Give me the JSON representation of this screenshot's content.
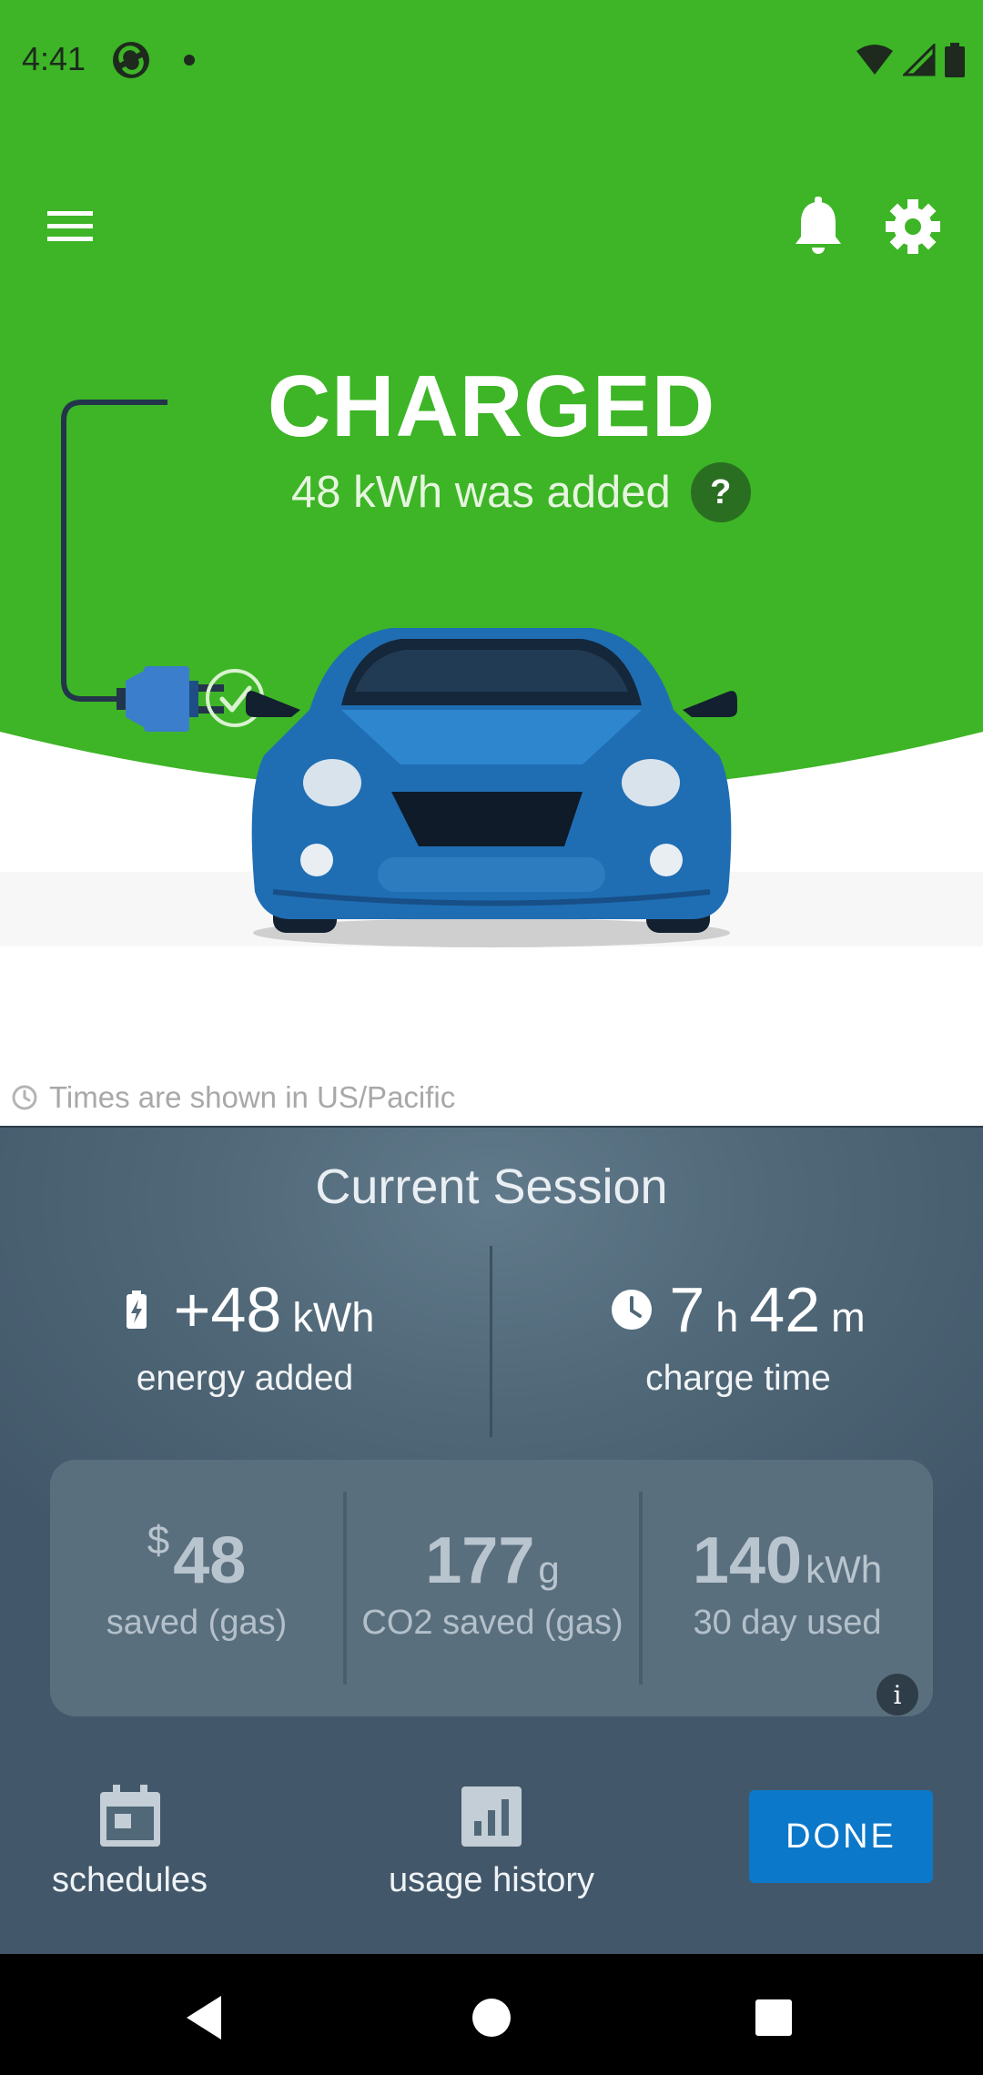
{
  "status_bar": {
    "time": "4:41",
    "icons": [
      "app-notification-icon",
      "dot-icon",
      "wifi-icon",
      "signal-icon",
      "battery-icon"
    ]
  },
  "header": {
    "menu_icon": "hamburger-menu-icon",
    "notifications_icon": "bell-icon",
    "settings_icon": "gear-icon"
  },
  "hero": {
    "status_title": "CHARGED",
    "added_text": "48 kWh was added",
    "help_label": "?",
    "colors": {
      "background": "#3db526",
      "accent_dark": "#2a6f21",
      "car": "#1f6eb4"
    }
  },
  "timezone_note": "Times are shown in US/Pacific",
  "session": {
    "title": "Current Session",
    "energy": {
      "value": "+48",
      "unit": "kWh",
      "label": "energy added",
      "icon": "battery-charging-icon"
    },
    "charge_time": {
      "hours": "7",
      "hours_unit": "h",
      "minutes": "42",
      "minutes_unit": "m",
      "label": "charge time",
      "icon": "clock-icon"
    },
    "savings": [
      {
        "prefix": "$",
        "value": "48",
        "unit": "",
        "label": "saved (gas)"
      },
      {
        "prefix": "",
        "value": "177",
        "unit": "g",
        "label": "CO2 saved (gas)"
      },
      {
        "prefix": "",
        "value": "140",
        "unit": "kWh",
        "label": "30 day used"
      }
    ],
    "info_label": "i"
  },
  "actions": {
    "schedules_label": "schedules",
    "usage_history_label": "usage history",
    "done_label": "DONE"
  },
  "nav": {
    "back": "back-icon",
    "home": "home-icon",
    "recents": "recents-icon"
  }
}
